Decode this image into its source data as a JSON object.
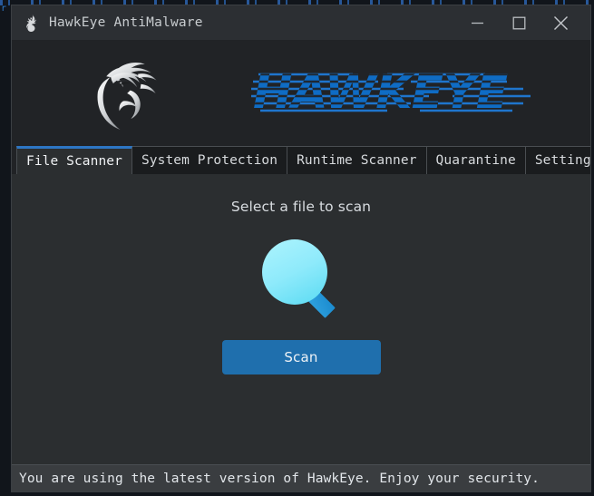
{
  "window": {
    "title": "HawkEye AntiMalware",
    "title_icon": "hawk-logo-icon",
    "controls": {
      "minimize_label": "Minimize",
      "maximize_label": "Maximize",
      "close_label": "Close"
    }
  },
  "branding": {
    "wordmark": "HAWKEYE",
    "mark_icon": "tribal-hawk-head-icon",
    "accent_color": "#0f6cc4",
    "speedline_color": "#1f7ad6"
  },
  "tabs": [
    {
      "label": "File Scanner",
      "active": true
    },
    {
      "label": "System Protection",
      "active": false
    },
    {
      "label": "Runtime Scanner",
      "active": false
    },
    {
      "label": "Quarantine",
      "active": false
    },
    {
      "label": "Settings",
      "active": false
    }
  ],
  "file_scanner": {
    "prompt": "Select a file to scan",
    "illustration_icon": "magnifying-glass-icon",
    "glass_lens_color_top": "#a4f0fc",
    "glass_lens_color_bottom": "#6fe0f5",
    "glass_handle_color": "#2196d8",
    "scan_button_label": "Scan",
    "scan_button_color": "#1f6fad"
  },
  "statusbar": {
    "message": "You are using the latest version of HawkEye. Enjoy your security."
  },
  "theme": {
    "window_bg": "#212326",
    "titlebar_bg": "#2c2f33",
    "content_bg": "#2b2e30",
    "tab_inactive_bg": "#1a1c1e",
    "tab_active_accent": "#2d76c4",
    "statusbar_bg": "#3a3d40",
    "border": "#4a4e52"
  }
}
